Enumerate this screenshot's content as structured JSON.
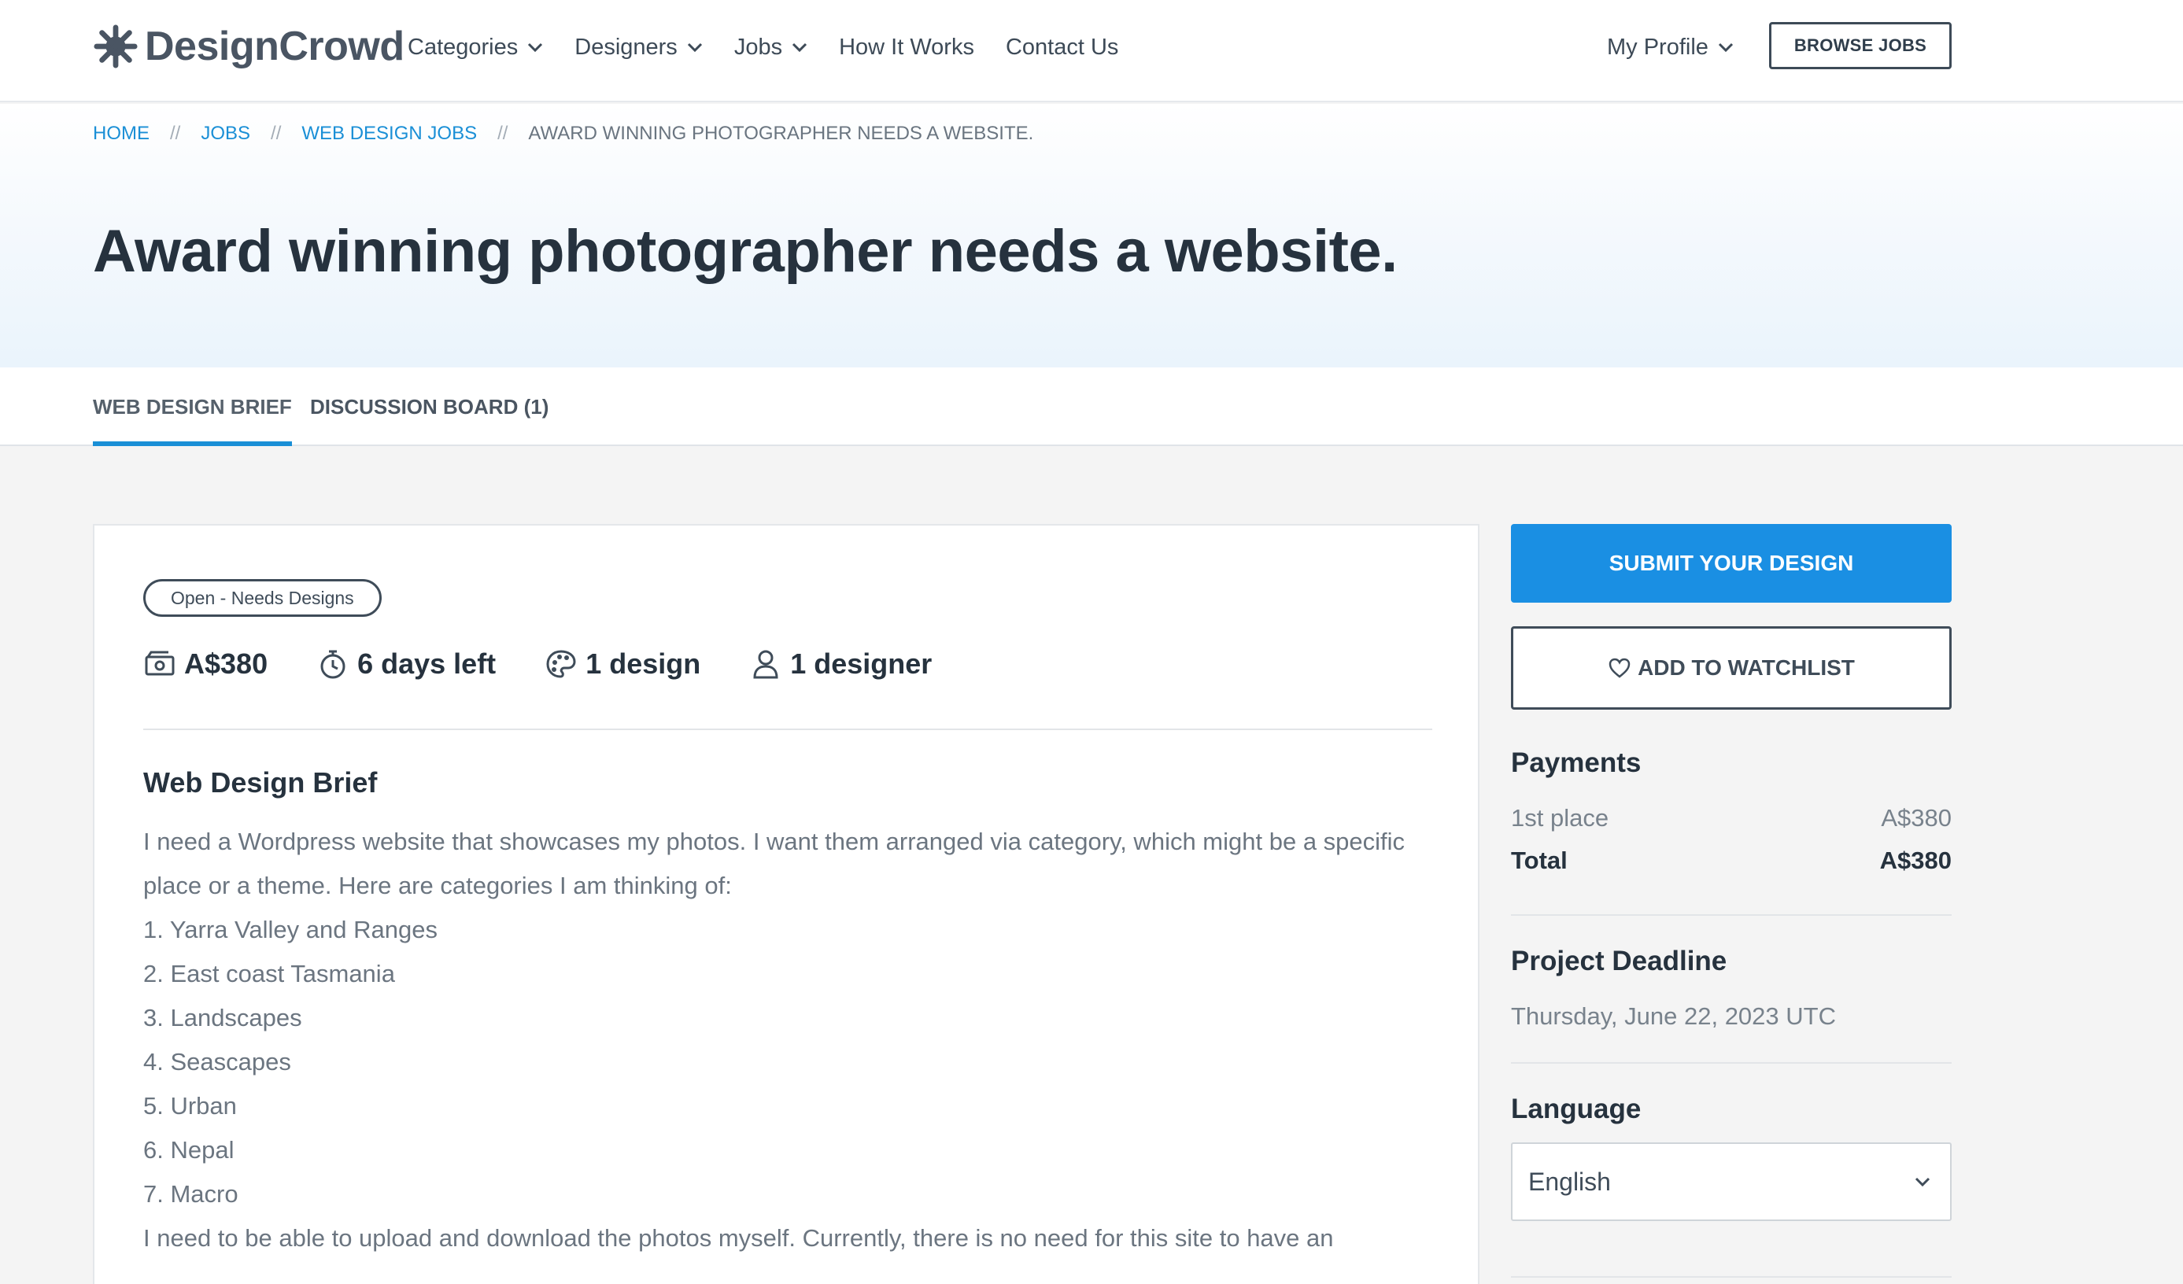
{
  "brand": {
    "name": "DesignCrowd"
  },
  "nav": [
    {
      "label": "Categories",
      "dropdown": true
    },
    {
      "label": "Designers",
      "dropdown": true
    },
    {
      "label": "Jobs",
      "dropdown": true
    },
    {
      "label": "How It Works",
      "dropdown": false
    },
    {
      "label": "Contact Us",
      "dropdown": false
    }
  ],
  "header": {
    "profile_label": "My Profile",
    "browse_jobs_label": "BROWSE JOBS"
  },
  "breadcrumb": {
    "items": [
      "HOME",
      "JOBS",
      "WEB DESIGN JOBS"
    ],
    "separator": "//",
    "current": "AWARD WINNING PHOTOGRAPHER NEEDS A WEBSITE."
  },
  "page": {
    "title": "Award winning photographer needs a website."
  },
  "tabs": [
    {
      "label": "WEB DESIGN BRIEF",
      "active": true
    },
    {
      "label": "DISCUSSION BOARD (1)",
      "active": false
    }
  ],
  "job": {
    "status": "Open - Needs Designs",
    "prize": "A$380",
    "time_left": "6 days left",
    "designs": "1 design",
    "designers": "1 designer"
  },
  "brief": {
    "title": "Web Design Brief",
    "lines": [
      "I need a Wordpress website that showcases my photos. I want them arranged via category, which might be a specific",
      "place or a theme. Here are categories I am thinking of:",
      "1. Yarra Valley and Ranges",
      "2. East coast Tasmania",
      "3. Landscapes",
      "4. Seascapes",
      "5. Urban",
      "6. Nepal",
      "7. Macro",
      "I need to be able to upload and download the photos myself. Currently, there is no need for this site to have an"
    ]
  },
  "sidebar": {
    "submit_label": "SUBMIT YOUR DESIGN",
    "watchlist_label": "ADD TO WATCHLIST",
    "payments": {
      "heading": "Payments",
      "first_label": "1st place",
      "first_value": "A$380",
      "total_label": "Total",
      "total_value": "A$380"
    },
    "deadline": {
      "heading": "Project Deadline",
      "value": "Thursday, June 22, 2023 UTC"
    },
    "language": {
      "heading": "Language",
      "value": "English"
    }
  },
  "colors": {
    "accent": "#1a8fe3",
    "link": "#1a8fd6",
    "text_dark": "#26323e",
    "text_muted": "#6b7580"
  },
  "icons": {
    "logo": "sun-splash-icon",
    "prize": "cash-icon",
    "time": "stopwatch-icon",
    "designs": "palette-icon",
    "designers": "user-icon",
    "watchlist": "heart-icon",
    "dropdown": "chevron-down-icon"
  }
}
